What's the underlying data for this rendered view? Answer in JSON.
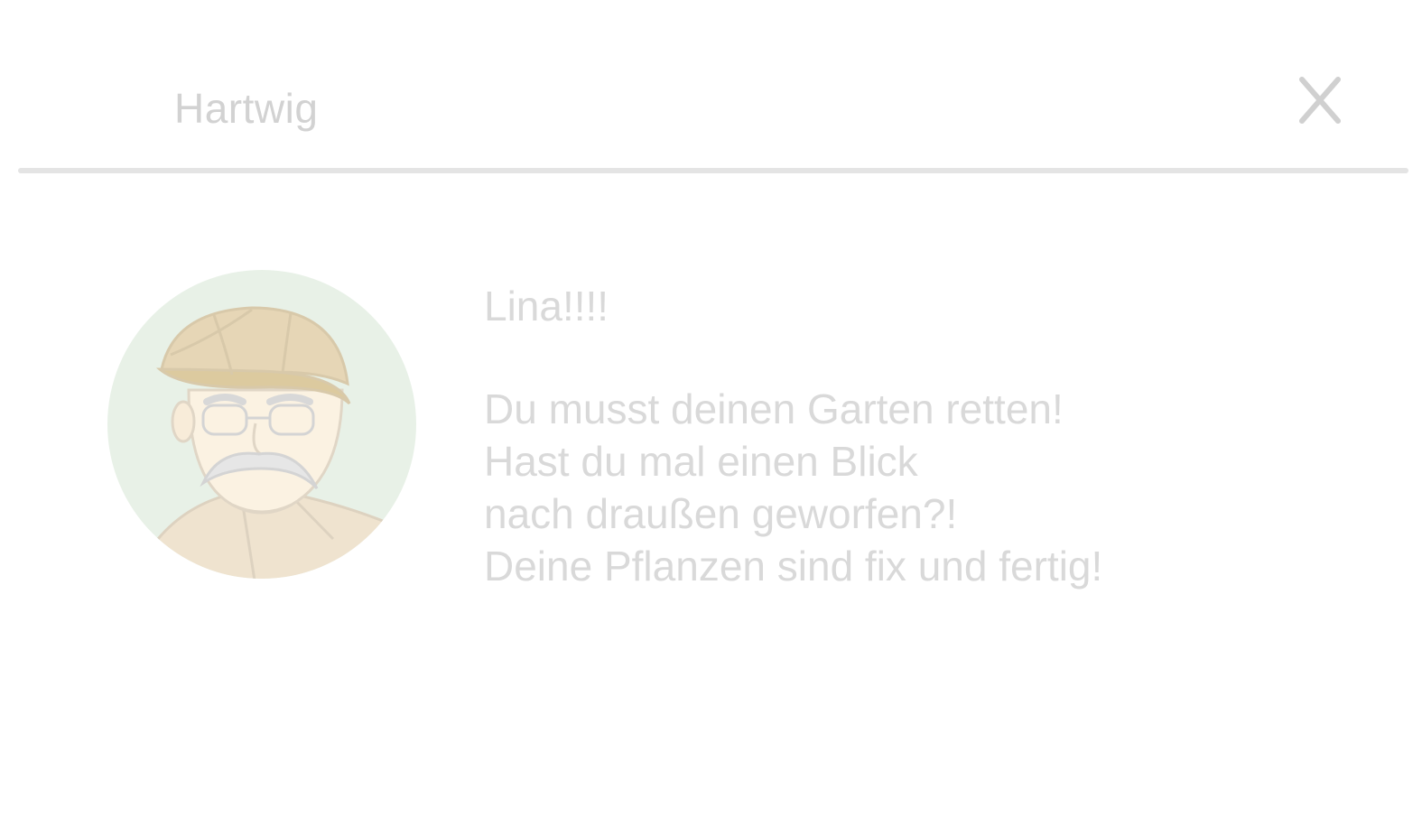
{
  "dialog": {
    "speaker_name": "Hartwig",
    "close_icon": "close-icon",
    "avatar_icon": "old-man-avatar-icon",
    "greeting": "Lina!!!!",
    "lines": [
      "Du musst deinen Garten retten!",
      "Hast du mal einen Blick",
      "nach draußen geworfen?!",
      "Deine Pflanzen sind fix und fertig!"
    ]
  },
  "colors": {
    "background": "#ffffff",
    "text": "#d9d9d9",
    "divider": "#e4e4e4",
    "avatar_circle": "#e8f1e7",
    "avatar_cap": "#e6d6b6",
    "avatar_coat": "#efe3cf"
  }
}
